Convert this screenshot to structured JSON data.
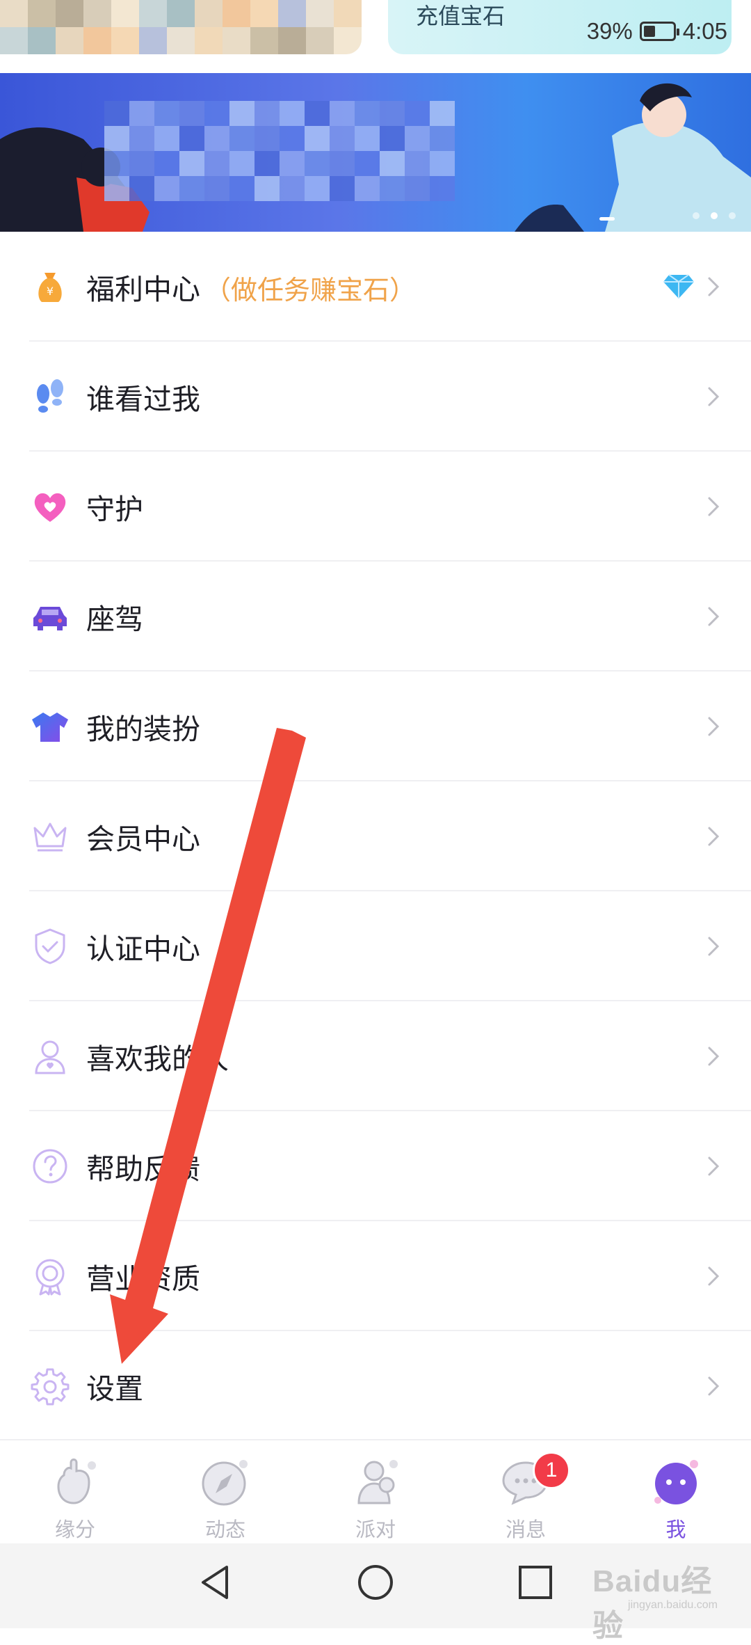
{
  "header": {
    "recharge_label": "充值宝石",
    "status": {
      "battery_percent": "39%",
      "battery_level": 0.39,
      "time": "4:05"
    }
  },
  "banner": {
    "dot_count": 3,
    "active_dot": 1
  },
  "menu": {
    "items": [
      {
        "label": "福利中心",
        "sub": "（做任务赚宝石）",
        "icon": "money-bag-icon",
        "accent": "#f0a34a"
      },
      {
        "label": "谁看过我",
        "icon": "footprints-icon"
      },
      {
        "label": "守护",
        "icon": "heart-icon"
      },
      {
        "label": "座驾",
        "icon": "car-icon"
      },
      {
        "label": "我的装扮",
        "icon": "tshirt-icon"
      },
      {
        "label": "会员中心",
        "icon": "crown-icon"
      },
      {
        "label": "认证中心",
        "icon": "shield-check-icon"
      },
      {
        "label": "喜欢我的人",
        "icon": "person-heart-icon"
      },
      {
        "label": "帮助反馈",
        "icon": "question-circle-icon"
      },
      {
        "label": "营业资质",
        "icon": "medal-icon"
      },
      {
        "label": "设置",
        "icon": "gear-icon"
      }
    ]
  },
  "bottom_nav": {
    "tabs": [
      {
        "label": "缘分",
        "icon": "hand-icon"
      },
      {
        "label": "动态",
        "icon": "compass-icon"
      },
      {
        "label": "派对",
        "icon": "people-icon"
      },
      {
        "label": "消息",
        "icon": "chat-bubble-icon",
        "badge": "1"
      },
      {
        "label": "我",
        "icon": "profile-face-icon",
        "active": true
      }
    ],
    "active_color": "#7a52e0",
    "badge_color": "#f23b48"
  },
  "system_nav": {
    "buttons": [
      "back-icon",
      "home-icon",
      "recents-icon"
    ]
  },
  "watermark": {
    "main": "Baidu经验",
    "sub": "jingyan.baidu.com"
  },
  "annotation": {
    "arrow_color": "#ee4a3a"
  }
}
